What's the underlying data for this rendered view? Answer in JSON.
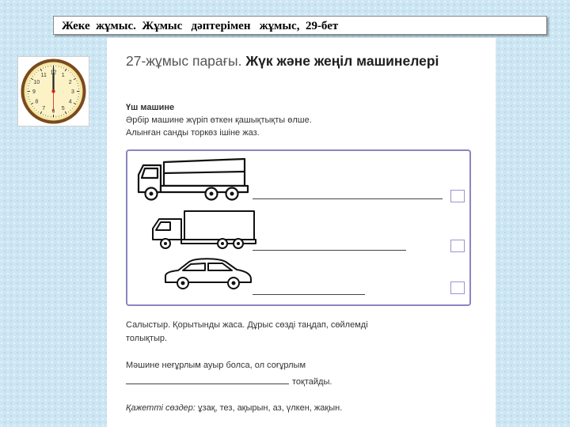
{
  "slide": {
    "title": "Жеке  жұмыс.  Жұмыс   дәптерімен   жұмыс,  29-бет"
  },
  "clock": {
    "numbers": [
      "12",
      "1",
      "2",
      "3",
      "4",
      "5",
      "6",
      "7",
      "8",
      "9",
      "10",
      "11"
    ],
    "time_shown": "12:00"
  },
  "worksheet": {
    "number_label": "27-жұмыс парағы.",
    "title": "Жүк және жеңіл машинелері",
    "section_heading": "Үш машине",
    "instructions": [
      "Әрбір машине жүріп өткен қашықтықты өлше.",
      "Алынған санды торкөз ішіне жаз."
    ],
    "vehicles": [
      {
        "name": "dump-truck",
        "icon": "dump-truck-icon"
      },
      {
        "name": "box-truck",
        "icon": "box-truck-icon"
      },
      {
        "name": "car",
        "icon": "car-icon"
      }
    ],
    "compare_text_1": "Салыстыр. Қорытынды жаса. Дұрыс сөзді таңдап, сөйлемді",
    "compare_text_2": "толықтыр.",
    "sentence_part_1": "Мәшине неғұрлым ауыр болса, ол соғұрлым",
    "sentence_part_2": "тоқтайды.",
    "words_label": "Қажетті сөздер:",
    "words_list": "ұзақ, тез, ақырын, аз, үлкен, жақын."
  }
}
